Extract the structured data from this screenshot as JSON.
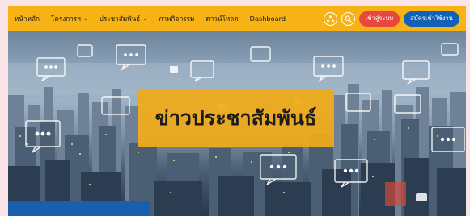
{
  "navbar": {
    "items": [
      {
        "label": "หน้าหลัก",
        "has_dropdown": false
      },
      {
        "label": "โครงการฯ",
        "has_dropdown": true
      },
      {
        "label": "ประชาสัมพันธ์",
        "has_dropdown": true
      },
      {
        "label": "ภาพกิจกรรม",
        "has_dropdown": false
      },
      {
        "label": "ดาวน์โหลด",
        "has_dropdown": false
      },
      {
        "label": "Dashboard",
        "has_dropdown": false
      }
    ],
    "dropdown_icon": "chevron-down-icon",
    "sitemap_icon": "sitemap-icon",
    "search_icon": "search-icon",
    "login_label": "เข้าสู่ระบบ",
    "register_label": "สมัครเข้าใช้งาน"
  },
  "hero": {
    "title": "ข่าวประชาสัมพันธ์",
    "background": "city-skyline-with-chat-bubble-icons"
  },
  "colors": {
    "navbar": "#f7b316",
    "login": "#e8473d",
    "register": "#1161b7",
    "page": "#fbe4e6",
    "title_box": "#efaa1a",
    "hero_bar": "#1a5fae"
  }
}
